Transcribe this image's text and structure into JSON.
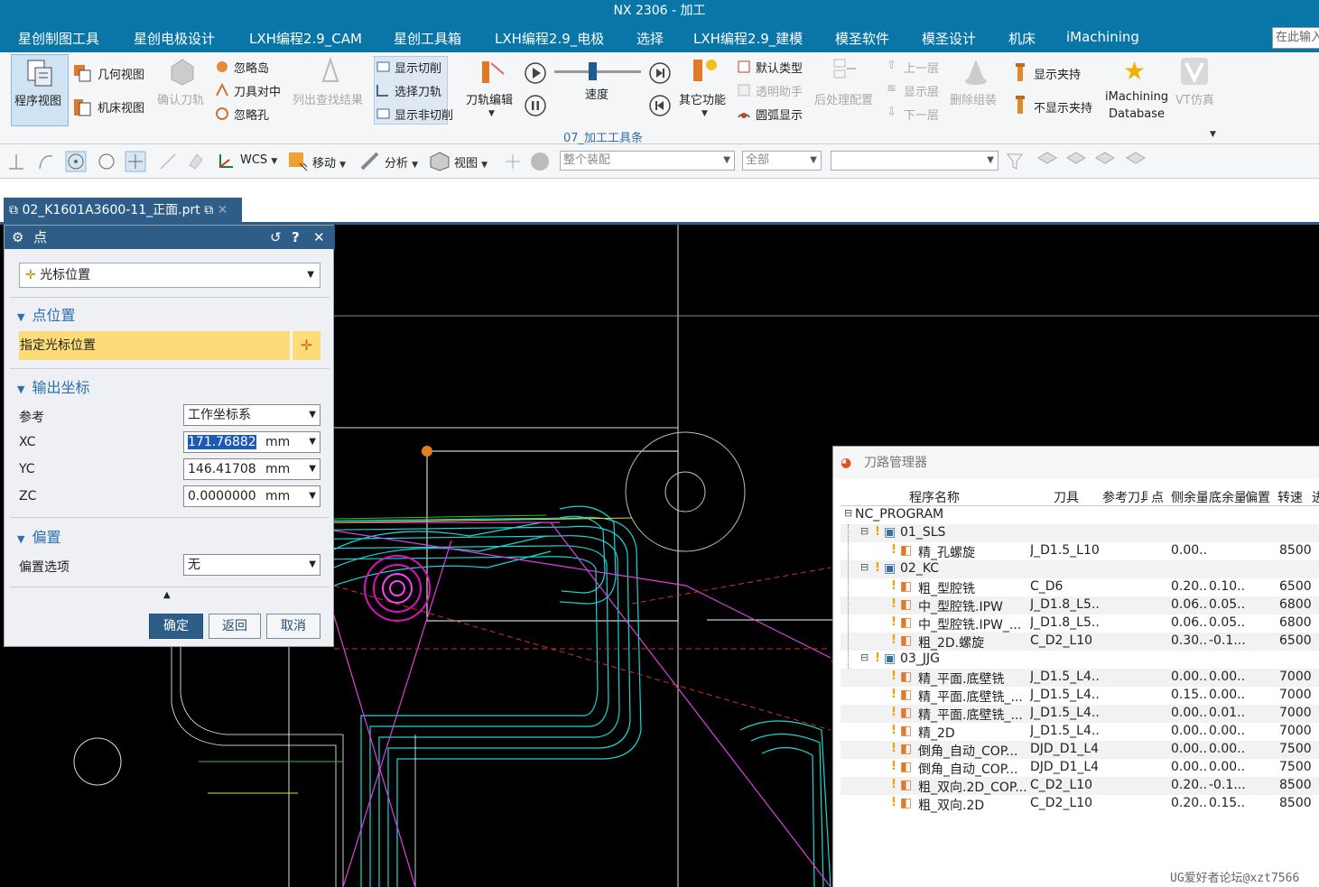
{
  "window": {
    "title": "NX 2306 - 加工"
  },
  "menu": {
    "items": [
      "星创制图工具",
      "星创电极设计",
      "LXH编程2.9_CAM",
      "星创工具箱",
      "LXH编程2.9_电极",
      "选择",
      "LXH编程2.9_建模",
      "模圣软件",
      "模圣设计",
      "机床",
      "iMachining"
    ],
    "search_placeholder": "在此输入"
  },
  "ribbon": {
    "program_view": "程序视图",
    "geometry_view": "几何视图",
    "machine_view": "机床视图",
    "confirm_toolpath": "确认刀轨",
    "ignore_island": "忽略岛",
    "tool_align": "刀具对中",
    "ignore_hole": "忽略孔",
    "list_results": "列出查找结果",
    "show_cut": "显示切削",
    "select_toolpath": "选择刀轨",
    "show_noncut": "显示非切削",
    "toolpath_edit": "刀轨编辑",
    "speed": "速度",
    "other_functions": "其它功能",
    "default_type": "默认类型",
    "transparent_helper": "透明助手",
    "arc_display": "圆弧显示",
    "postprocess_config": "后处理配置",
    "level_up": "上一层",
    "show_level": "显示层",
    "level_down": "下一层",
    "delete_assembly": "删除组装",
    "show_fixture": "显示夹持",
    "hide_fixture": "不显示夹持",
    "imachining_db_1": "iMachining",
    "imachining_db_2": "Database",
    "vt_sim": "VT仿真",
    "group_label": "07_加工工具条"
  },
  "toolbar2": {
    "wcs": "WCS",
    "move": "移动",
    "analysis": "分析",
    "view": "视图",
    "assembly_filter": "整个装配",
    "all_filter": "全部",
    "empty_filter": ""
  },
  "file_tab": {
    "name": "02_K1601A3600-11_正面.prt"
  },
  "dialog": {
    "title": "点",
    "type_value": "光标位置",
    "section_point": "点位置",
    "specify_cursor": "指定光标位置",
    "section_output": "输出坐标",
    "reference_label": "参考",
    "reference_value": "工作坐标系",
    "xc_label": "XC",
    "xc_value": "171.76882",
    "yc_label": "YC",
    "yc_value": "146.41708",
    "zc_label": "ZC",
    "zc_value": "0.0000000",
    "unit": "mm",
    "section_offset": "偏置",
    "offset_label": "偏置选项",
    "offset_value": "无",
    "ok": "确定",
    "back": "返回",
    "cancel": "取消"
  },
  "navigator": {
    "title": "刀路管理器",
    "columns": [
      "程序名称",
      "刀具",
      "参考刀具",
      "点",
      "侧余量",
      "底余量",
      "偏置",
      "转速",
      "进"
    ],
    "rows": [
      {
        "indent": 0,
        "name": "NC_PROGRAM",
        "tool": "",
        "side": "",
        "floor": "",
        "speed": "",
        "kind": "root"
      },
      {
        "indent": 1,
        "name": "01_SLS",
        "tool": "",
        "side": "",
        "floor": "",
        "speed": "",
        "kind": "group"
      },
      {
        "indent": 2,
        "name": "精_孔螺旋",
        "tool": "J_D1.5_L10",
        "side": "0.00..",
        "floor": "",
        "speed": "8500",
        "kind": "op"
      },
      {
        "indent": 1,
        "name": "02_KC",
        "tool": "",
        "side": "",
        "floor": "",
        "speed": "",
        "kind": "group"
      },
      {
        "indent": 2,
        "name": "粗_型腔铣",
        "tool": "C_D6",
        "side": "0.20..",
        "floor": "0.10..",
        "speed": "6500",
        "kind": "op"
      },
      {
        "indent": 2,
        "name": "中_型腔铣.IPW",
        "tool": "J_D1.8_L5...",
        "side": "0.06..",
        "floor": "0.05..",
        "speed": "6800",
        "kind": "op"
      },
      {
        "indent": 2,
        "name": "中_型腔铣.IPW_...",
        "tool": "J_D1.8_L5...",
        "side": "0.06..",
        "floor": "0.05..",
        "speed": "6800",
        "kind": "op"
      },
      {
        "indent": 2,
        "name": "粗_2D.螺旋",
        "tool": "C_D2_L10",
        "side": "0.30..",
        "floor": "-0.1...",
        "speed": "6500",
        "kind": "op"
      },
      {
        "indent": 1,
        "name": "03_JJG",
        "tool": "",
        "side": "",
        "floor": "",
        "speed": "",
        "kind": "group"
      },
      {
        "indent": 2,
        "name": "精_平面.底壁铣",
        "tool": "J_D1.5_L4...",
        "side": "0.00..",
        "floor": "0.00..",
        "speed": "7000",
        "kind": "op"
      },
      {
        "indent": 2,
        "name": "精_平面.底壁铣_...",
        "tool": "J_D1.5_L4...",
        "side": "0.15..",
        "floor": "0.00..",
        "speed": "7000",
        "kind": "op"
      },
      {
        "indent": 2,
        "name": "精_平面.底壁铣_...",
        "tool": "J_D1.5_L4...",
        "side": "0.00..",
        "floor": "0.01..",
        "speed": "7000",
        "kind": "op"
      },
      {
        "indent": 2,
        "name": "精_2D",
        "tool": "J_D1.5_L4...",
        "side": "0.00..",
        "floor": "0.00..",
        "speed": "7000",
        "kind": "op"
      },
      {
        "indent": 2,
        "name": "倒角_自动_COP...",
        "tool": "DJD_D1_L4",
        "side": "0.00..",
        "floor": "0.00..",
        "speed": "7500",
        "kind": "op"
      },
      {
        "indent": 2,
        "name": "倒角_自动_COP...",
        "tool": "DJD_D1_L4",
        "side": "0.00..",
        "floor": "0.00..",
        "speed": "7500",
        "kind": "op"
      },
      {
        "indent": 2,
        "name": "粗_双向.2D_COP...",
        "tool": "C_D2_L10",
        "side": "0.20..",
        "floor": "-0.1...",
        "speed": "8500",
        "kind": "op"
      },
      {
        "indent": 2,
        "name": "粗_双向.2D",
        "tool": "C_D2_L10",
        "side": "0.20..",
        "floor": "0.15..",
        "speed": "8500",
        "kind": "op"
      }
    ]
  },
  "watermark": "UG爱好者论坛@xzt7566",
  "colors": {
    "accent": "#0a76a8",
    "dialog_header": "#2e5e87",
    "highlight": "#fbdc78"
  }
}
